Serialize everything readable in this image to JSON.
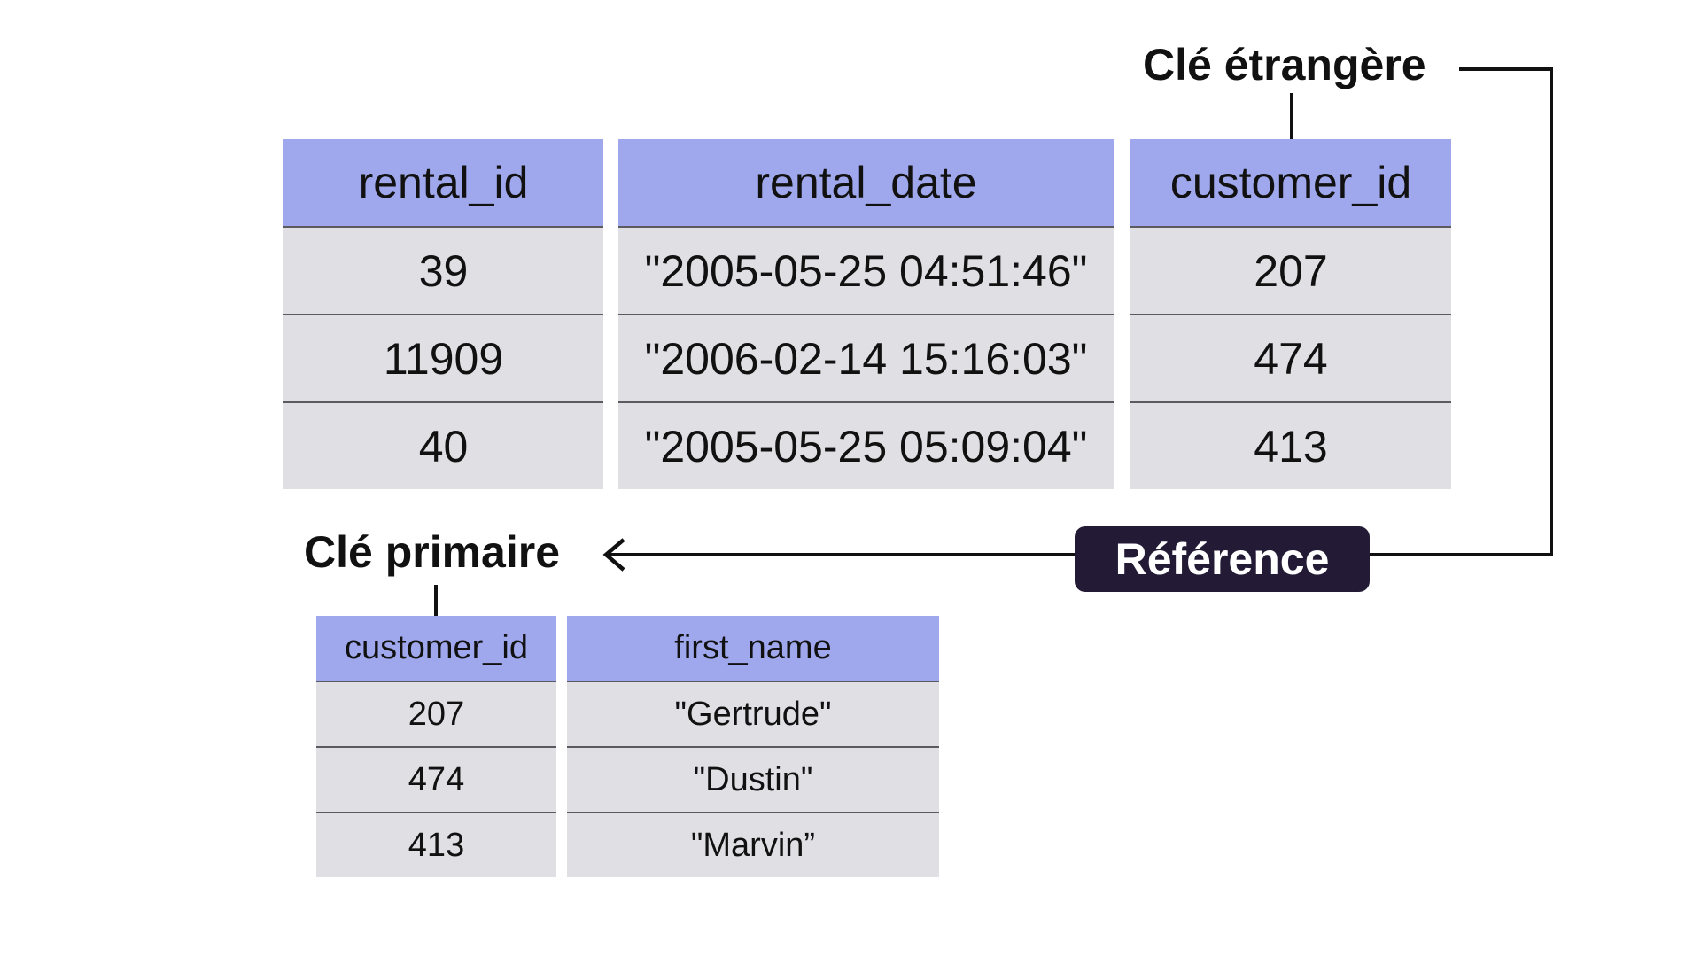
{
  "labels": {
    "foreign_key": "Clé étrangère",
    "primary_key": "Clé primaire",
    "reference": "Référence"
  },
  "rental_table": {
    "columns": [
      {
        "header": "rental_id",
        "values": [
          "39",
          "11909",
          "40"
        ]
      },
      {
        "header": "rental_date",
        "values": [
          "\"2005-05-25 04:51:46\"",
          "\"2006-02-14 15:16:03\"",
          "\"2005-05-25 05:09:04\""
        ]
      },
      {
        "header": "customer_id",
        "values": [
          "207",
          "474",
          "413"
        ]
      }
    ]
  },
  "customer_table": {
    "columns": [
      {
        "header": "customer_id",
        "values": [
          "207",
          "474",
          "413"
        ]
      },
      {
        "header": "first_name",
        "values": [
          "\"Gertrude\"",
          "\"Dustin\"",
          "\"Marvin”"
        ]
      }
    ]
  },
  "colors": {
    "header": "#9fa8ec",
    "cell": "#e0dfe4",
    "badge": "#231a35"
  }
}
